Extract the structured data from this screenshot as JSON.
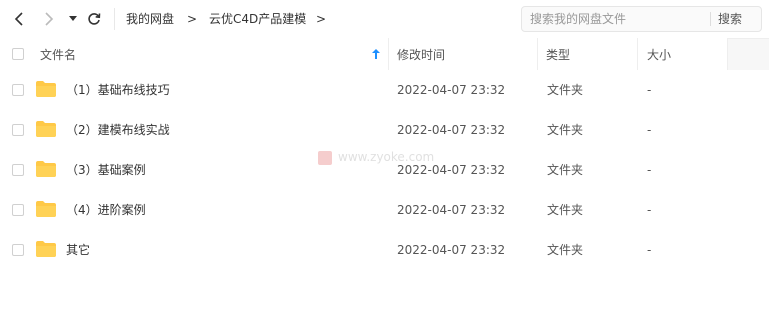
{
  "toolbar": {
    "icons": [
      "chevron-left-icon",
      "chevron-right-icon",
      "dropdown-caret-icon",
      "refresh-icon"
    ],
    "breadcrumb": [
      "我的网盘",
      "云优C4D产品建模"
    ],
    "separator": ">"
  },
  "search": {
    "placeholder": "搜索我的网盘文件",
    "button_label": "搜索"
  },
  "table": {
    "columns": {
      "name": "文件名",
      "modified": "修改时间",
      "type": "类型",
      "size": "大小"
    },
    "sort_icon": "sort-up-arrow-icon",
    "rows": [
      {
        "name": "（1）基础布线技巧",
        "modified": "2022-04-07 23:32",
        "type": "文件夹",
        "size": "-"
      },
      {
        "name": "（2）建模布线实战",
        "modified": "2022-04-07 23:32",
        "type": "文件夹",
        "size": "-"
      },
      {
        "name": "（3）基础案例",
        "modified": "2022-04-07 23:32",
        "type": "文件夹",
        "size": "-"
      },
      {
        "name": "（4）进阶案例",
        "modified": "2022-04-07 23:32",
        "type": "文件夹",
        "size": "-"
      },
      {
        "name": "其它",
        "modified": "2022-04-07 23:32",
        "type": "文件夹",
        "size": "-"
      }
    ]
  },
  "watermark": "www.zyoke.com",
  "colors": {
    "folder": "#ffc947",
    "accent": "#1e90ff"
  }
}
